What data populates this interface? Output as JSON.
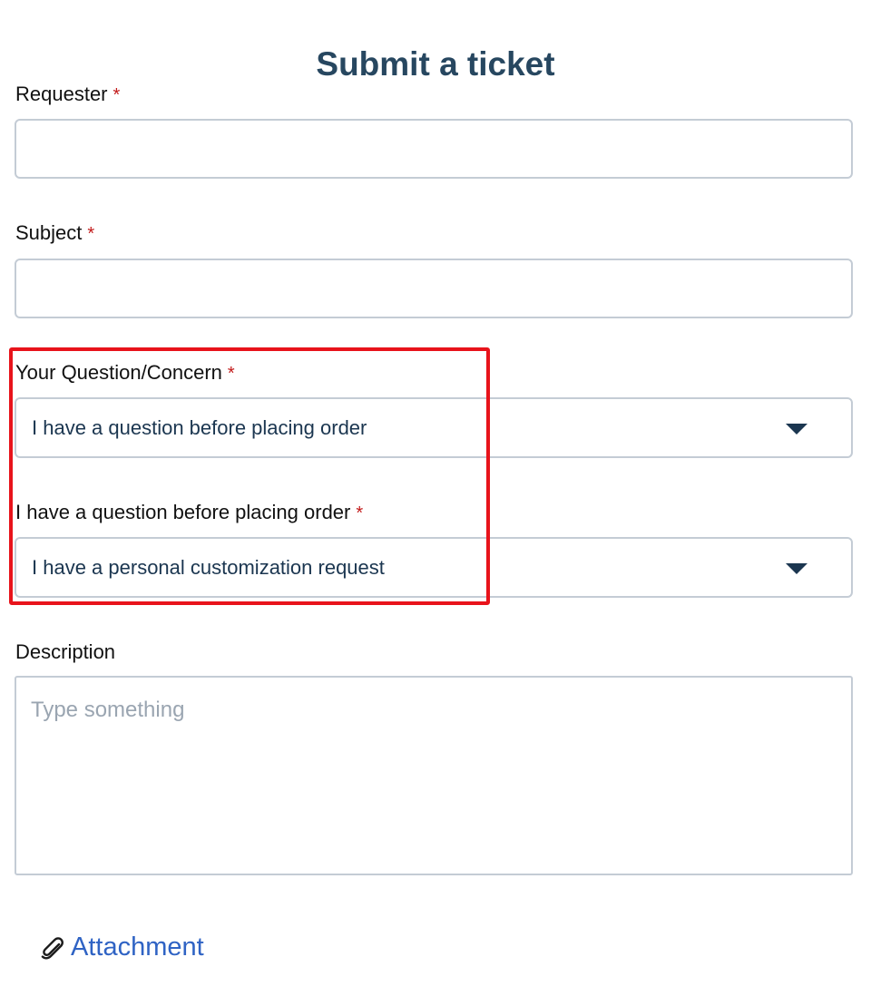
{
  "page": {
    "title": "Submit a ticket"
  },
  "form": {
    "requester": {
      "label": "Requester",
      "required_mark": "*",
      "value": ""
    },
    "subject": {
      "label": "Subject",
      "required_mark": "*",
      "value": ""
    },
    "question_concern": {
      "label": "Your Question/Concern",
      "required_mark": "*",
      "selected": "I have a question before placing order"
    },
    "before_order": {
      "label": "I have a question before placing order",
      "required_mark": "*",
      "selected": "I have a personal customization request"
    },
    "description": {
      "label": "Description",
      "placeholder": "Type something",
      "value": ""
    },
    "attachment": {
      "label": "Attachment",
      "icon": "paperclip-icon"
    }
  },
  "colors": {
    "title": "#274760",
    "required": "#c21a1a",
    "input_border": "#c4ccd5",
    "select_text": "#1b3650",
    "highlight_box": "#e8131b",
    "link": "#2f63c4",
    "placeholder": "#9aa5b1"
  }
}
